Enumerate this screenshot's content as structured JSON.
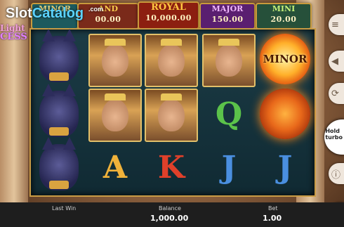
{
  "watermark": {
    "part1": "Slot",
    "part2": "Catalog",
    "suffix": ".com"
  },
  "game_title": {
    "line1": "Light",
    "line2": "CESS"
  },
  "jackpots": [
    {
      "name": "MINOR",
      "value": "",
      "color": "#e8d27a",
      "bg": "#1d5a5e"
    },
    {
      "name": "AND",
      "value": "00.00",
      "color": "#f5c84a",
      "bg": "#7a2a1a"
    },
    {
      "name": "ROYAL",
      "value": "10,000.00",
      "color": "#ffc640",
      "bg": "#8c1f10"
    },
    {
      "name": "MAJOR",
      "value": "150.00",
      "color": "#f2b8ff",
      "bg": "#5a1f70"
    },
    {
      "name": "MINI",
      "value": "20.00",
      "color": "#c6f27a",
      "bg": "#26503a"
    }
  ],
  "reel_symbols": {
    "row1": [
      "cat",
      "cleopatra",
      "cleopatra",
      "cleopatra",
      "sun-minor"
    ],
    "row2": [
      "cat",
      "cleopatra",
      "cleopatra",
      "Q",
      "sun"
    ],
    "row3": [
      "cat",
      "A",
      "K",
      "J",
      "J"
    ]
  },
  "letters": {
    "Q": "Q",
    "A": "A",
    "K": "K",
    "J": "J"
  },
  "letter_colors": {
    "Q": "#5bc24a",
    "A": "#f0b23a",
    "K": "#e0402a",
    "J": "#4a8fe0"
  },
  "sun_label": "MINOR",
  "side_buttons": {
    "hold_label": "Hold",
    "turbo_label": "turbo"
  },
  "bottom_bar": {
    "last_win_label": "Last Win",
    "balance_label": "Balance",
    "balance_value": "1,000.00",
    "bet_label": "Bet",
    "bet_value": "1.00"
  }
}
